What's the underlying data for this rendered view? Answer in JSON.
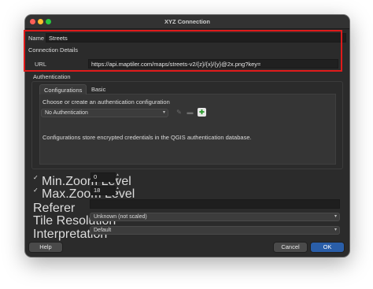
{
  "window": {
    "title": "XYZ Connection"
  },
  "name_field": {
    "label": "Name",
    "value": "Streets"
  },
  "connection_details": {
    "label": "Connection Details"
  },
  "url_field": {
    "label": "URL",
    "value": "https://api.maptiler.com/maps/streets-v2/{z}/{x}/{y}@2x.png?key="
  },
  "authentication": {
    "label": "Authentication",
    "tabs": [
      {
        "label": "Configurations"
      },
      {
        "label": "Basic"
      }
    ],
    "choose_text": "Choose or create an authentication configuration",
    "selected_config": "No Authentication",
    "info_text": "Configurations store encrypted credentials in the QGIS authentication database."
  },
  "min_zoom": {
    "label": "Min.Zoom Level",
    "value": "0",
    "checked": true
  },
  "max_zoom": {
    "label": "Max.Zoom Level",
    "value": "18",
    "checked": true
  },
  "referer": {
    "label": "Referer",
    "value": ""
  },
  "tile_resolution": {
    "label": "Tile Resolution",
    "selected": "Unknown (not scaled)"
  },
  "interpretation": {
    "label": "Interpretation",
    "selected": "Default"
  },
  "buttons": {
    "help": "Help",
    "cancel": "Cancel",
    "ok": "OK"
  },
  "colors": {
    "highlight": "#e01b1b",
    "accent": "#2a5ea8",
    "window_bg": "#2b2b2b"
  }
}
